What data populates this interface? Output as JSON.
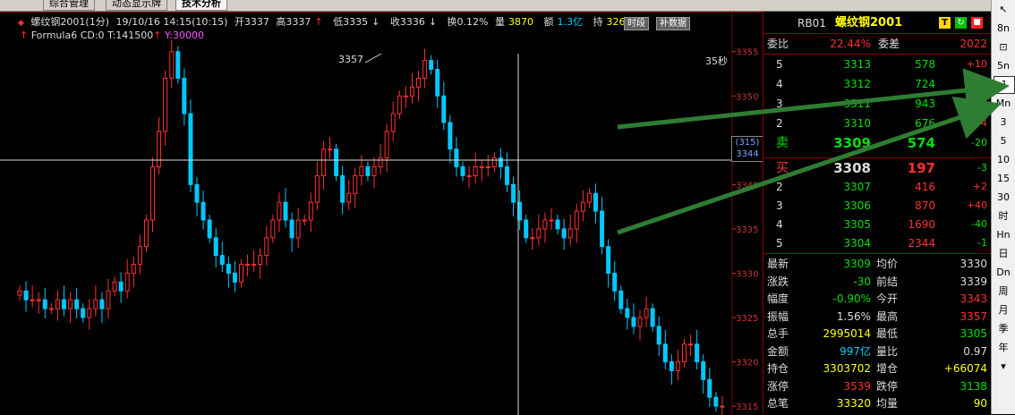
{
  "tabs": [
    "综合管理",
    "动态显示牌",
    "技术分析"
  ],
  "header": {
    "symbol": "螺纹钢2001(1分)",
    "datetime": "19/10/16 14:15(10:15)",
    "open": "开3337",
    "high": "高3337",
    "low": "低3335",
    "close": "收3336",
    "turnover": "换0.12%",
    "volume_label": "量",
    "volume": "3870",
    "amount_label": "额",
    "amount": "1.3亿",
    "oi_label": "持",
    "oi": "32631",
    "btn_timeshare": "时段",
    "btn_supplement": "补数据"
  },
  "formula": {
    "name": "Formula6",
    "cd": "CD:0",
    "t": "T:141500",
    "y": "Y:30000"
  },
  "chart_labels": {
    "peak": "3357",
    "countdown": "35秒",
    "cursor_top": "(315)",
    "cursor_bottom": "3344"
  },
  "chart_data": {
    "type": "candlestick",
    "y_ticks": [
      "3355",
      "3350",
      "3345",
      "3340",
      "3335",
      "3330",
      "3325",
      "3320",
      "3315"
    ],
    "ylim": [
      3314,
      3358
    ],
    "closes": [
      3328,
      3327,
      3327,
      3327,
      3326,
      3326,
      3327,
      3326,
      3327,
      3326,
      3325,
      3326,
      3327,
      3326,
      3328,
      3329,
      3328,
      3330,
      3331,
      3333,
      3336,
      3342,
      3346,
      3352,
      3355,
      3352,
      3348,
      3340,
      3338,
      3336,
      3334,
      3332,
      3331,
      3330,
      3329,
      3331,
      3331,
      3331,
      3332,
      3334,
      3336,
      3338,
      3336,
      3334,
      3336,
      3336,
      3338,
      3341,
      3344,
      3344,
      3341,
      3338,
      3339,
      3341,
      3342,
      3341,
      3342,
      3343,
      3346,
      3348,
      3350,
      3350,
      3351,
      3352,
      3354,
      3353,
      3350,
      3347,
      3344,
      3342,
      3341,
      3341,
      3342,
      3342,
      3342,
      3343,
      3342,
      3340,
      3338,
      3336,
      3334,
      3334,
      3335,
      3336,
      3336,
      3335,
      3334,
      3335,
      3337,
      3338,
      3339,
      3337,
      3333,
      3330,
      3328,
      3326,
      3325,
      3324,
      3325,
      3326,
      3324,
      3322,
      3320,
      3319,
      3320,
      3322,
      3322,
      3320,
      3318,
      3316,
      3315,
      3315
    ]
  },
  "panel": {
    "code": "RB01",
    "name": "螺纹钢2001",
    "icon_t": "T",
    "wb_label": "委比",
    "wb_value": "22.44%",
    "wc_label": "委差",
    "wc_value": "2022",
    "asks": [
      {
        "lvl": "5",
        "price": "3313",
        "vol": "578",
        "chg": "+10"
      },
      {
        "lvl": "4",
        "price": "3312",
        "vol": "724",
        "chg": ""
      },
      {
        "lvl": "3",
        "price": "3311",
        "vol": "943",
        "chg": "+10"
      },
      {
        "lvl": "2",
        "price": "3310",
        "vol": "676",
        "chg": "+4"
      },
      {
        "lvl": "卖",
        "price": "3309",
        "vol": "574",
        "chg": "-20"
      }
    ],
    "bids": [
      {
        "lvl": "买",
        "price": "3308",
        "vol": "197",
        "chg": "-3"
      },
      {
        "lvl": "2",
        "price": "3307",
        "vol": "416",
        "chg": "+2"
      },
      {
        "lvl": "3",
        "price": "3306",
        "vol": "870",
        "chg": "+40"
      },
      {
        "lvl": "4",
        "price": "3305",
        "vol": "1690",
        "chg": "-40"
      },
      {
        "lvl": "5",
        "price": "3304",
        "vol": "2344",
        "chg": "-1"
      }
    ],
    "stats": [
      {
        "l1": "最新",
        "v1": "3309",
        "c1": "green",
        "l2": "均价",
        "v2": "3330",
        "c2": "white"
      },
      {
        "l1": "涨跌",
        "v1": "-30",
        "c1": "green",
        "l2": "前结",
        "v2": "3339",
        "c2": "white"
      },
      {
        "l1": "幅度",
        "v1": "-0.90%",
        "c1": "green",
        "l2": "今开",
        "v2": "3343",
        "c2": "red"
      },
      {
        "l1": "振幅",
        "v1": "1.56%",
        "c1": "white",
        "l2": "最高",
        "v2": "3357",
        "c2": "red"
      },
      {
        "l1": "总手",
        "v1": "2995014",
        "c1": "yellow",
        "l2": "最低",
        "v2": "3305",
        "c2": "green"
      },
      {
        "l1": "金额",
        "v1": "997亿",
        "c1": "cyan",
        "l2": "量比",
        "v2": "0.97",
        "c2": "white"
      },
      {
        "l1": "持仓",
        "v1": "3303702",
        "c1": "yellow",
        "l2": "增仓",
        "v2": "+66074",
        "c2": "yellow"
      },
      {
        "l1": "涨停",
        "v1": "3539",
        "c1": "red",
        "l2": "跌停",
        "v2": "3138",
        "c2": "green"
      },
      {
        "l1": "总笔",
        "v1": "33320",
        "c1": "yellow",
        "l2": "均量",
        "v2": "90",
        "c2": "yellow"
      }
    ]
  },
  "toolbar": [
    "8n",
    "",
    "5n",
    "1",
    "Mn",
    "3",
    "5",
    "10",
    "15",
    "30",
    "时",
    "Hn",
    "日",
    "Dn",
    "周",
    "月",
    "季",
    "年",
    ""
  ],
  "colors": {
    "up": "#ff3030",
    "down": "#00c8ff",
    "arrow": "#2e7d32"
  }
}
